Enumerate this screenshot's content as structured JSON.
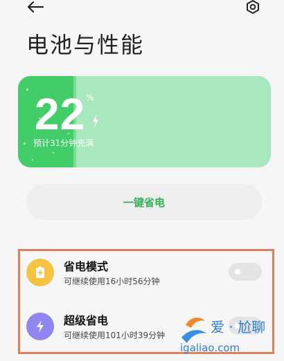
{
  "header": {
    "back_icon": "arrow-left-icon",
    "settings_icon": "gear-icon",
    "title": "电池与性能"
  },
  "battery": {
    "level_percent": 22,
    "value": "22",
    "unit": "%",
    "charge_hint": "预计31分钟充满",
    "fill_color": "#43cd69",
    "card_color": "#a9e8be"
  },
  "one_key": {
    "label": "一键省电"
  },
  "modes": [
    {
      "title": "省电模式",
      "subtitle": "可继续使用16小时56分钟",
      "icon": "battery-saver-icon",
      "icon_color": "#f6c242",
      "enabled": false
    },
    {
      "title": "超级省电",
      "subtitle": "可继续使用101小时39分钟",
      "icon": "lightning-icon",
      "icon_color": "#8f86ef",
      "enabled": false
    }
  ],
  "watermark": {
    "text_cn": "爱 · 尬聊",
    "text_url": "igaliao.com"
  },
  "colors": {
    "accent_green": "#34b05e",
    "highlight_border": "#e0805a"
  }
}
